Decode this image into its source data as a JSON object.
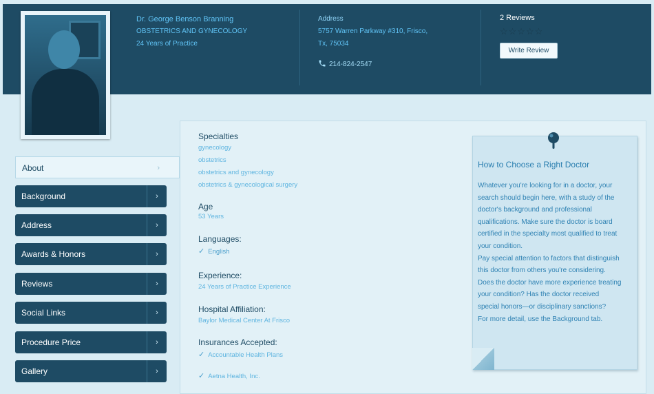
{
  "header": {
    "doctor_name": "Dr. George Benson Branning",
    "specialty": "OBSTETRICS AND GYNECOLOGY",
    "experience": "24 Years of Practice",
    "address_label": "Address",
    "address_line1": "5757 Warren Parkway #310, Frisco,",
    "address_line2": "Tx, 75034",
    "phone": "214-824-2547",
    "reviews_count": "2 Reviews",
    "stars": "☆☆☆☆☆",
    "write_review_label": "Write Review"
  },
  "sidebar": {
    "items": [
      {
        "label": "About"
      },
      {
        "label": "Background"
      },
      {
        "label": "Address"
      },
      {
        "label": "Awards & Honors"
      },
      {
        "label": "Reviews"
      },
      {
        "label": "Social Links"
      },
      {
        "label": "Procedure Price"
      },
      {
        "label": "Gallery"
      }
    ],
    "chevron": "›"
  },
  "details": {
    "specialties_heading": "Specialties",
    "specialties": [
      "gynecology",
      "obstetrics",
      "obstetrics and gynecology",
      "obstetrics & gynecological surgery"
    ],
    "age_heading": "Age",
    "age": "53 Years",
    "languages_heading": "Languages:",
    "language": "English",
    "experience_heading": "Experience:",
    "experience": "24 Years of Practice Experience",
    "hospital_heading": "Hospital Affiliation:",
    "hospital": "Baylor Medical Center At Frisco",
    "insurances_heading": "Insurances Accepted:",
    "insurances": [
      "Accountable Health Plans",
      "Aetna Health, Inc."
    ],
    "check": "✓"
  },
  "tip": {
    "title": "How to Choose a Right Doctor",
    "lines": [
      "Whatever you're looking for in a doctor, your",
      "search should begin here, with a study of the",
      "doctor's background and professional",
      "qualifications. Make sure the doctor is board",
      "certified in the specialty most qualified to treat",
      "your condition.",
      "Pay special attention to factors that distinguish",
      "this doctor from others you're considering.",
      "Does the doctor have more experience treating",
      "your condition? Has the doctor received",
      "special honors—or disciplinary sanctions?",
      "For more detail, use the Background tab."
    ]
  },
  "colors": {
    "header_bg": "#1e4b64",
    "nav_bg": "#1e4b64",
    "link_blue": "#5fb5e0",
    "page_bg": "#d9ecf4"
  }
}
